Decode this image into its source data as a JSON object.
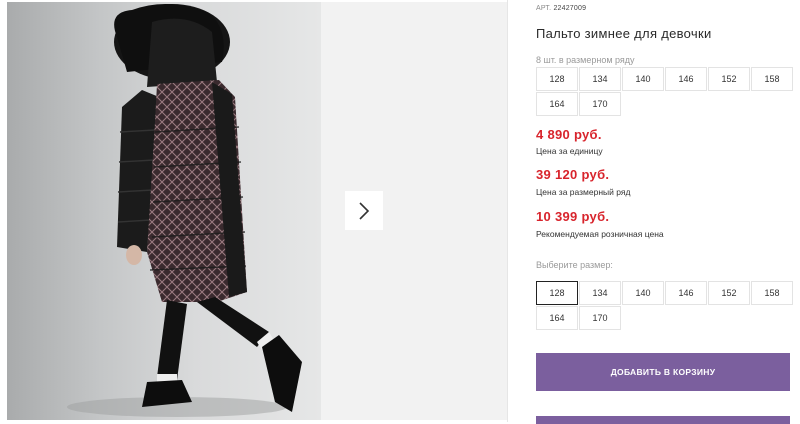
{
  "product": {
    "article_label": "АРТ.",
    "article_value": "22427009",
    "title": "Пальто зимнее для девочки",
    "pack_note": "8 шт. в размерном ряду",
    "pack_sizes": [
      "128",
      "134",
      "140",
      "146",
      "152",
      "158",
      "164",
      "170"
    ],
    "prices": [
      {
        "value": "4 890 руб.",
        "note": "Цена за единицу"
      },
      {
        "value": "39 120 руб.",
        "note": "Цена за размерный ряд"
      },
      {
        "value": "10 399 руб.",
        "note": "Рекомендуемая розничная цена"
      }
    ],
    "choose_size_label": "Выберите размер:",
    "choose_sizes": [
      "128",
      "134",
      "140",
      "146",
      "152",
      "158",
      "164",
      "170"
    ],
    "selected_size": "128",
    "add_to_cart_label": "ДОБАВИТЬ В КОРЗИНУ"
  },
  "colors": {
    "accent": "#7b5f9e",
    "price": "#d8242c"
  },
  "icons": {
    "next": "chevron-right-icon"
  }
}
